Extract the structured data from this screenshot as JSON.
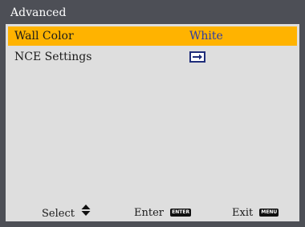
{
  "menu": {
    "title": "Advanced",
    "items": [
      {
        "label": "Wall Color",
        "value": "White",
        "selected": true
      },
      {
        "label": "NCE Settings",
        "value": "",
        "icon": "enter-arrow-icon",
        "selected": false
      }
    ]
  },
  "footer": {
    "select_label": "Select",
    "select_icon": "up-down-arrow-icon",
    "enter_label": "Enter",
    "enter_key": "ENTER",
    "exit_label": "Exit",
    "exit_key": "MENU"
  },
  "colors": {
    "frame": "#4d4f56",
    "panel": "#dedede",
    "highlight": "#ffb300",
    "value_text": "#2a3aa8"
  }
}
